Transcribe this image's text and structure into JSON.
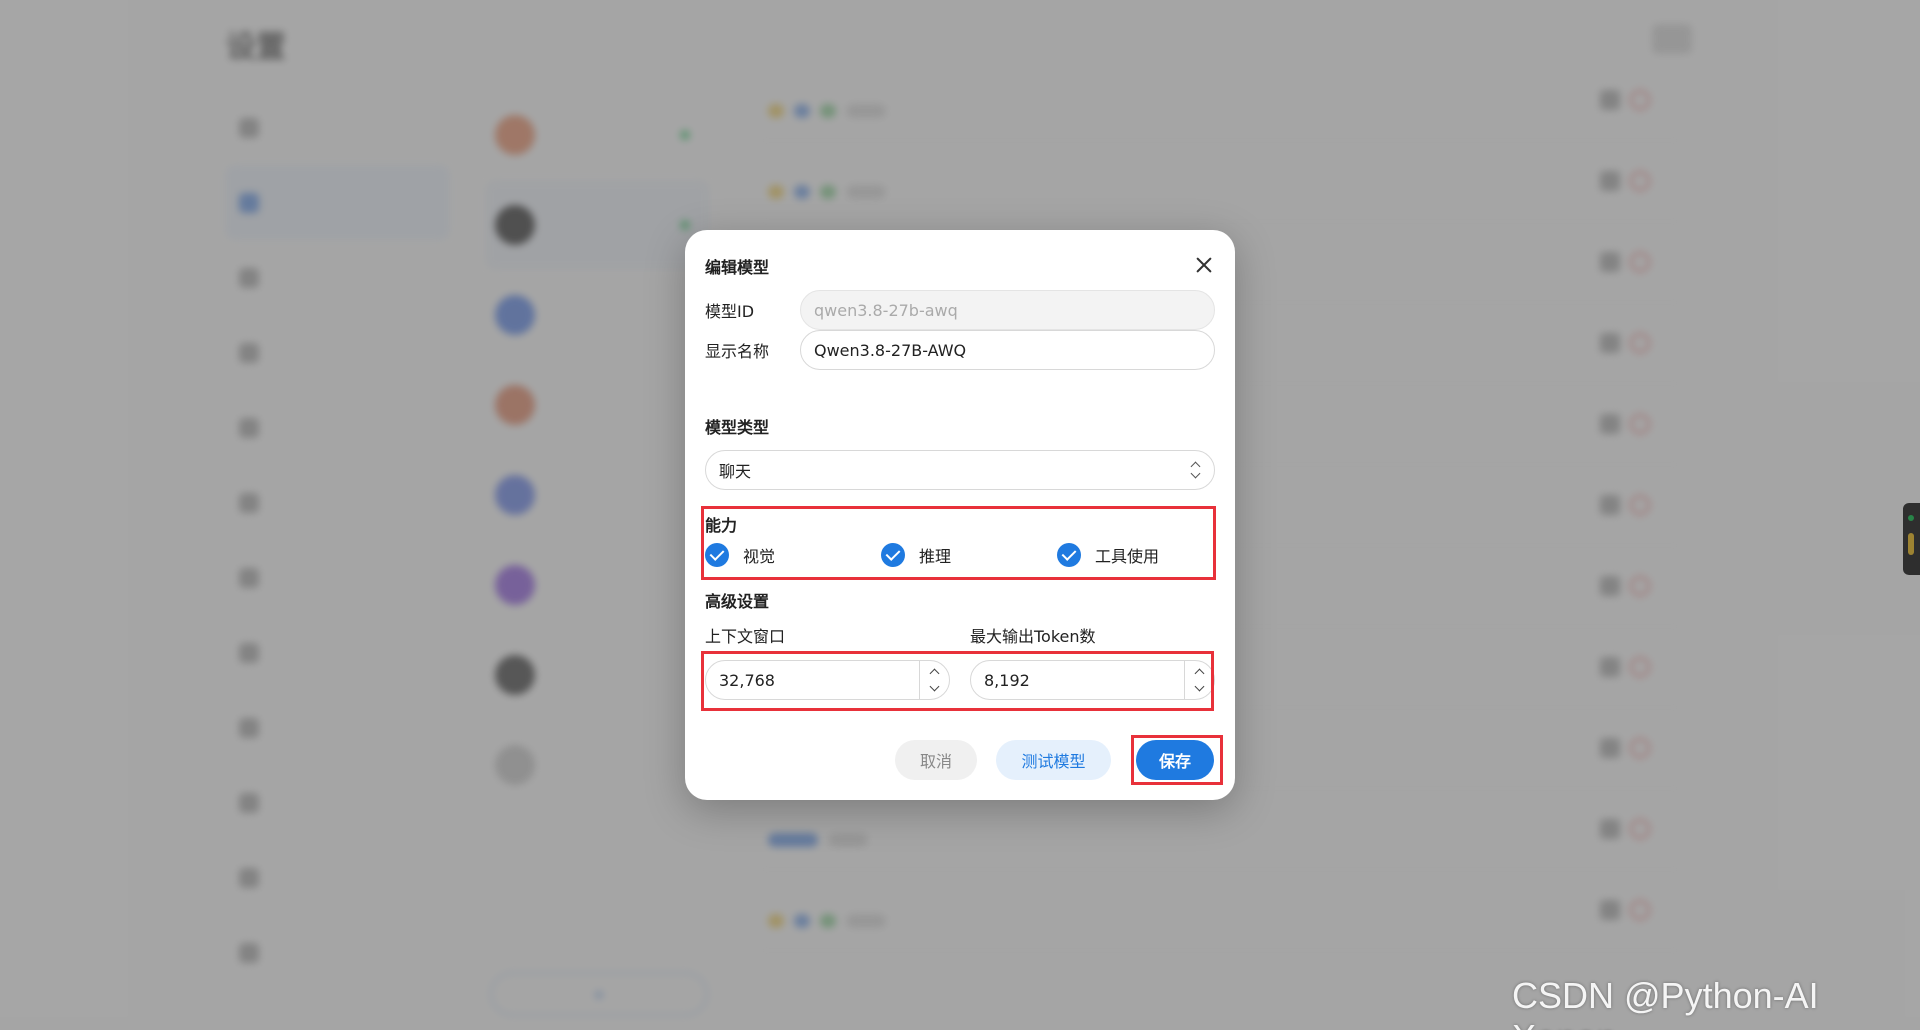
{
  "modal": {
    "title": "编辑模型",
    "model_id_label": "模型ID",
    "model_id_value": "qwen3.8-27b-awq",
    "display_name_label": "显示名称",
    "display_name_value": "Qwen3.8-27B-AWQ",
    "model_type_title": "模型类型",
    "model_type_value": "聊天",
    "capabilities_title": "能力",
    "capabilities": [
      {
        "label": "视觉",
        "checked": true
      },
      {
        "label": "推理",
        "checked": true
      },
      {
        "label": "工具使用",
        "checked": true
      }
    ],
    "advanced_title": "高级设置",
    "context_window_label": "上下文窗口",
    "context_window_value": "32,768",
    "max_tokens_label": "最大输出Token数",
    "max_tokens_value": "8,192",
    "cancel_label": "取消",
    "test_label": "测试模型",
    "save_label": "保存"
  },
  "watermark": "CSDN @Python-AI Xenon",
  "colors": {
    "accent": "#1f7ae0",
    "highlight": "#e8313a"
  }
}
